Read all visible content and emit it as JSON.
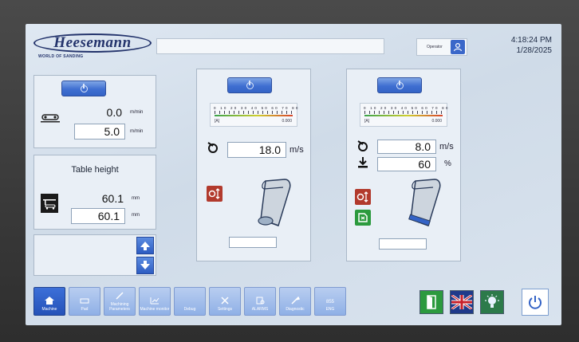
{
  "header": {
    "logo_text": "Heesemann",
    "logo_sub": "WORLD OF SANDING",
    "operator": "Operator",
    "time": "4:18:24 PM",
    "date": "1/28/2025"
  },
  "left_panel": {
    "speed_value": "0.0",
    "speed_unit": "m/min",
    "speed_setpoint": "5.0",
    "speed_setpoint_unit": "m/min"
  },
  "table_height": {
    "title": "Table height",
    "actual": "60.1",
    "actual_unit": "mm",
    "setpoint": "60.1",
    "setpoint_unit": "mm"
  },
  "unit1": {
    "scale_nums": "0 10 20 30 40 50 60 70 80",
    "scale_left": "[A]",
    "scale_value": "0.000",
    "belt_speed": "18.0",
    "belt_speed_unit": "m/s"
  },
  "unit2": {
    "scale_nums": "0 10 20 30 40 50 60 70 80",
    "scale_left": "[A]",
    "scale_value": "0.000",
    "belt_speed": "8.0",
    "belt_speed_unit": "m/s",
    "pressure": "60",
    "pressure_unit": "%"
  },
  "nav": [
    {
      "label": "Machine",
      "icon": "home-icon"
    },
    {
      "label": "Pad",
      "icon": "pad-icon"
    },
    {
      "label": "Machining Parameters",
      "icon": "machining-icon"
    },
    {
      "label": "Machine monitor",
      "icon": "monitor-icon"
    },
    {
      "label": "Debug",
      "icon": "debug-icon"
    },
    {
      "label": "Settings",
      "icon": "settings-icon"
    },
    {
      "label": "ALARMS",
      "icon": "alarms-icon"
    },
    {
      "label": "Diagnostic",
      "icon": "diagnostic-icon"
    },
    {
      "label": "ENG",
      "icon": "language-icon"
    }
  ],
  "colors": {
    "accent": "#3463c6",
    "green": "#2c9a3e",
    "red": "#b23a2d"
  }
}
